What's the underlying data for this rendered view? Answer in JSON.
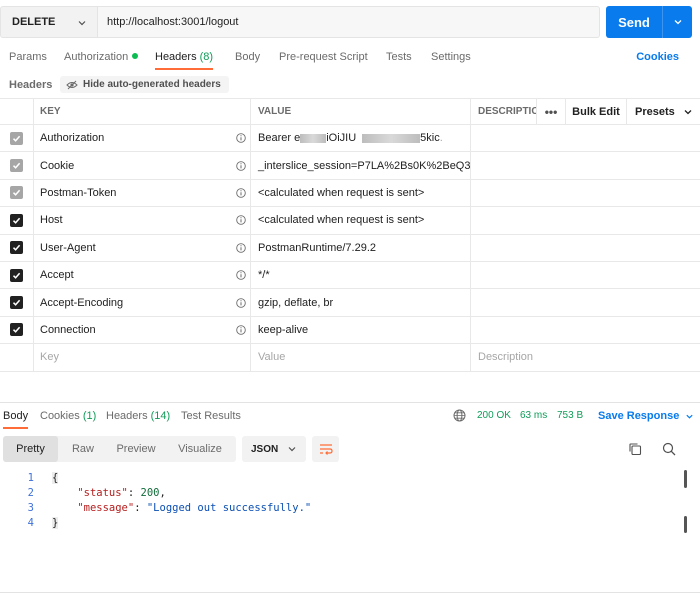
{
  "request": {
    "method": "DELETE",
    "url": "http://localhost:3001/logout",
    "send_label": "Send"
  },
  "tabs": [
    {
      "label": "Params"
    },
    {
      "label": "Authorization"
    },
    {
      "label": "Headers",
      "count": "(8)"
    },
    {
      "label": "Body"
    },
    {
      "label": "Pre-request Script"
    },
    {
      "label": "Tests"
    },
    {
      "label": "Settings"
    }
  ],
  "cookies_link": "Cookies",
  "headers_section": {
    "title": "Headers",
    "hide_auto_label": "Hide auto-generated headers"
  },
  "table": {
    "columns": {
      "key": "KEY",
      "value": "VALUE",
      "description": "DESCRIPTIC",
      "more": "•••",
      "bulk_edit": "Bulk Edit",
      "presets": "Presets"
    },
    "rows": [
      {
        "key": "Authorization",
        "value_prefix": "Bearer e",
        "value_mid": "iOiJIU",
        "value_end": "5kic",
        "checked": "dim"
      },
      {
        "key": "Cookie",
        "value": "_interslice_session=P7LA%2Bs0K%2BeQ3...",
        "checked": "dim"
      },
      {
        "key": "Postman-Token",
        "value": "<calculated when request is sent>",
        "checked": "dim"
      },
      {
        "key": "Host",
        "value": "<calculated when request is sent>",
        "checked": "on"
      },
      {
        "key": "User-Agent",
        "value": "PostmanRuntime/7.29.2",
        "checked": "on"
      },
      {
        "key": "Accept",
        "value": "*/*",
        "checked": "on"
      },
      {
        "key": "Accept-Encoding",
        "value": "gzip, deflate, br",
        "checked": "on"
      },
      {
        "key": "Connection",
        "value": "keep-alive",
        "checked": "on"
      }
    ],
    "placeholders": {
      "key": "Key",
      "value": "Value",
      "description": "Description"
    }
  },
  "response": {
    "tabs": [
      {
        "label": "Body"
      },
      {
        "label": "Cookies",
        "count": "(1)"
      },
      {
        "label": "Headers",
        "count": "(14)"
      },
      {
        "label": "Test Results"
      }
    ],
    "status": "200 OK",
    "time": "63 ms",
    "size": "753 B",
    "save_label": "Save Response",
    "views": [
      "Pretty",
      "Raw",
      "Preview",
      "Visualize"
    ],
    "format": "JSON",
    "lines": [
      "1",
      "2",
      "3",
      "4"
    ],
    "body": {
      "open": "{",
      "status_key": "\"status\"",
      "status_val": "200",
      "message_key": "\"message\"",
      "message_val": "\"Logged out successfully.\"",
      "close": "}"
    }
  },
  "colors": {
    "accent": "#097bed",
    "tab_underline": "#ff6c37",
    "success": "#0f9d58"
  }
}
